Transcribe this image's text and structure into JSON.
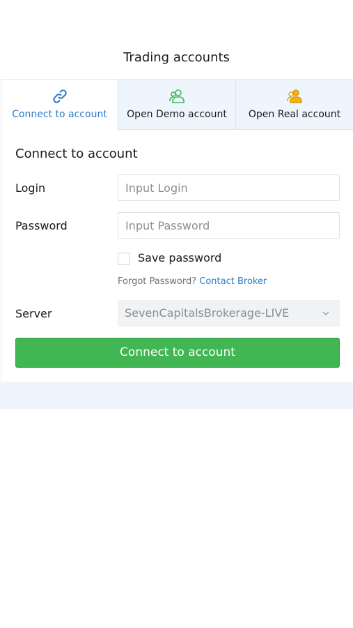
{
  "header": {
    "title": "Trading accounts"
  },
  "tabs": [
    {
      "label": "Connect to account",
      "icon": "link-icon",
      "color": "#2a7ac8",
      "active": true
    },
    {
      "label": "Open Demo account",
      "icon": "users-icon",
      "color": "#41b653",
      "active": false
    },
    {
      "label": "Open Real account",
      "icon": "users-icon",
      "color": "#f0a500",
      "active": false
    }
  ],
  "form": {
    "title": "Connect to account",
    "login_label": "Login",
    "login_placeholder": "Input Login",
    "password_label": "Password",
    "password_placeholder": "Input Password",
    "save_password_label": "Save password",
    "save_password_checked": false,
    "forgot_text": "Forgot Password?",
    "contact_broker": "Contact Broker",
    "server_label": "Server",
    "server_value": "SevenCapitalsBrokerage-LIVE",
    "connect_button": "Connect to account"
  },
  "colors": {
    "accent": "#2a7ac8",
    "button": "#41b653",
    "tab_background": "#eef5fc"
  }
}
